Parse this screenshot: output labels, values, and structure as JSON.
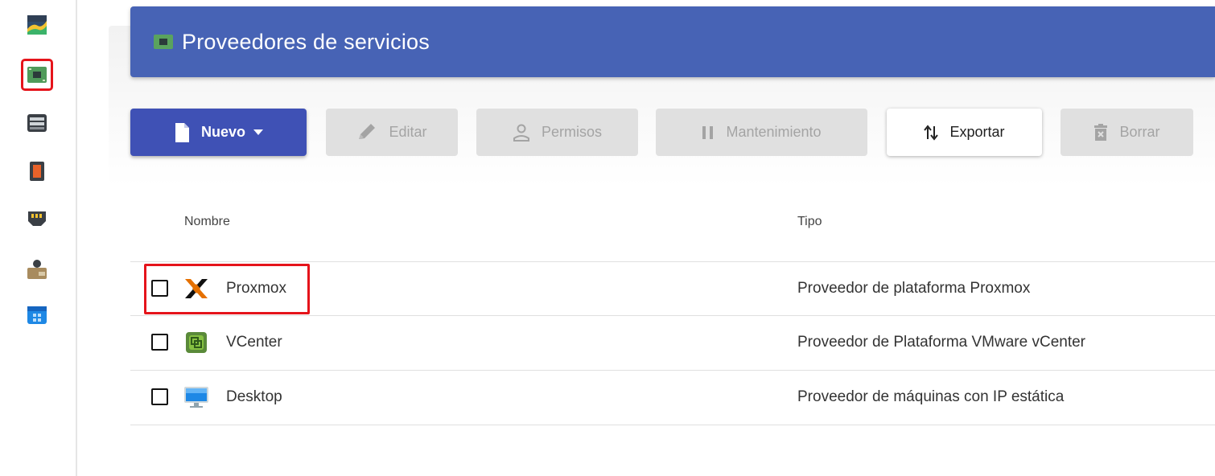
{
  "colors": {
    "header_bg": "#4763b5",
    "primary_btn": "#3f51b5",
    "highlight": "#e5141b"
  },
  "sidebar": {
    "items": [
      {
        "icon": "chart-icon"
      },
      {
        "icon": "provider-board-icon",
        "active": true
      },
      {
        "icon": "server-icon"
      },
      {
        "icon": "orange-device-icon"
      },
      {
        "icon": "network-switch-icon"
      },
      {
        "icon": "user-wallet-icon"
      },
      {
        "icon": "calendar-icon"
      }
    ]
  },
  "header": {
    "icon": "provider-board-icon",
    "title": "Proveedores de servicios"
  },
  "toolbar": {
    "new_label": "Nuevo",
    "edit_label": "Editar",
    "permissions_label": "Permisos",
    "maintenance_label": "Mantenimiento",
    "export_label": "Exportar",
    "delete_label": "Borrar"
  },
  "table": {
    "columns": [
      "Nombre",
      "Tipo"
    ],
    "rows": [
      {
        "name": "Proxmox",
        "type": "Proveedor de plataforma Proxmox",
        "icon": "proxmox-icon",
        "checked": false
      },
      {
        "name": "VCenter",
        "type": "Proveedor de Plataforma VMware vCenter",
        "icon": "vcenter-icon",
        "checked": false
      },
      {
        "name": "Desktop",
        "type": "Proveedor de máquinas con IP estática",
        "icon": "desktop-icon",
        "checked": false
      }
    ]
  }
}
